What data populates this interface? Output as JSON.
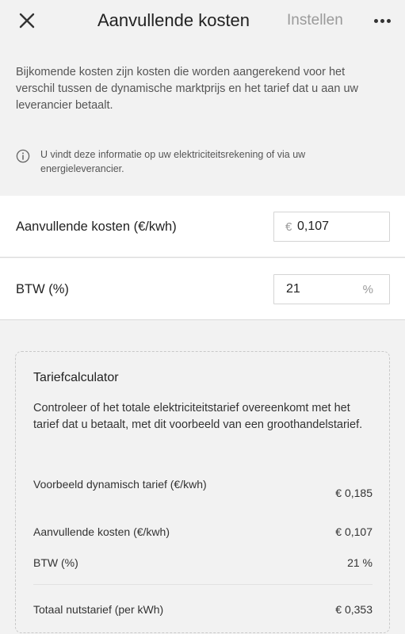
{
  "header": {
    "title": "Aanvullende kosten",
    "action_label": "Instellen",
    "close_icon": "close-icon",
    "more_icon": "more-horizontal-icon"
  },
  "intro": "Bijkomende kosten zijn kosten die worden aangerekend voor het verschil tussen de dynamische marktprijs en het tarief dat u aan uw leverancier betaalt.",
  "info": {
    "icon": "info-icon",
    "text": "U vindt deze informatie op uw elektriciteitsrekening of via uw energieleverancier."
  },
  "fields": {
    "extra_costs": {
      "label": "Aanvullende kosten (€/kwh)",
      "prefix": "€",
      "value": "0,107"
    },
    "vat": {
      "label": "BTW (%)",
      "value": "21",
      "suffix": "%"
    }
  },
  "calculator": {
    "title": "Tariefcalculator",
    "description": "Controleer of het totale elektriciteitstarief overeenkomt met het tarief dat u betaalt, met dit voorbeeld van een groothandelstarief.",
    "rows": [
      {
        "label": "Voorbeeld dynamisch tarief (€/kwh)",
        "value": "€ 0,185"
      },
      {
        "label": "Aanvullende kosten (€/kwh)",
        "value": "€ 0,107"
      },
      {
        "label": "BTW (%)",
        "value": "21 %"
      }
    ],
    "total": {
      "label": "Totaal nutstarief (per kWh)",
      "value": "€ 0,353"
    }
  },
  "colors": {
    "background": "#f2f2f2",
    "card": "#ffffff",
    "muted_action": "#9a9a9a"
  }
}
